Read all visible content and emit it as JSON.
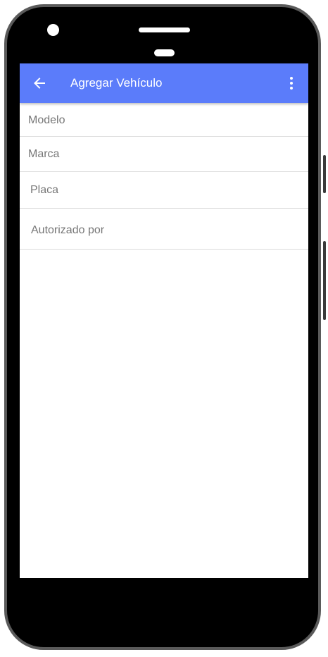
{
  "app_bar": {
    "title": "Agregar Vehículo",
    "back_icon": "arrow-left-icon",
    "menu_icon": "more-vert-icon",
    "color": "#5b7cfa"
  },
  "form": {
    "fields": [
      {
        "placeholder": "Modelo",
        "value": ""
      },
      {
        "placeholder": "Marca",
        "value": ""
      },
      {
        "placeholder": "Placa",
        "value": ""
      },
      {
        "placeholder": "Autorizado por",
        "value": ""
      }
    ]
  }
}
